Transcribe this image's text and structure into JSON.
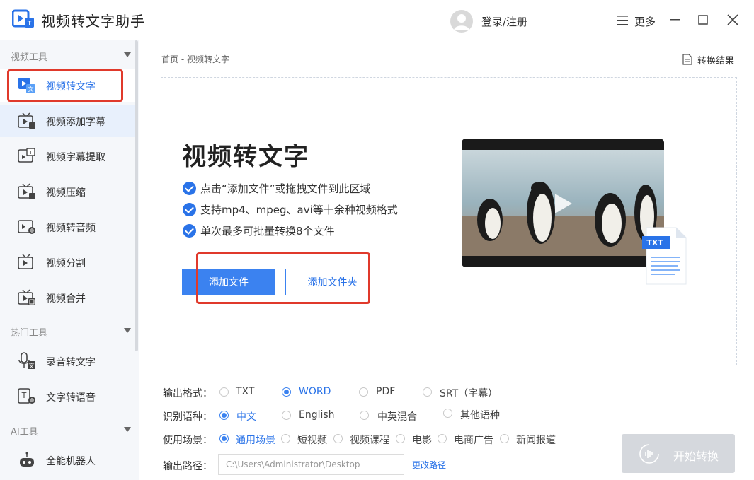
{
  "titlebar": {
    "app_title": "视频转文字助手",
    "login": "登录/注册",
    "more": "更多"
  },
  "sidebar": {
    "groups": [
      {
        "label": "视频工具"
      },
      {
        "label": "热门工具"
      },
      {
        "label": "AI工具"
      }
    ],
    "items": [
      {
        "label": "视频转文字",
        "icon": "video-to-text-icon"
      },
      {
        "label": "视频添加字幕",
        "icon": "tv-subtitle-icon"
      },
      {
        "label": "视频字幕提取",
        "icon": "subtitle-extract-icon"
      },
      {
        "label": "视频压缩",
        "icon": "video-compress-icon"
      },
      {
        "label": "视频转音频",
        "icon": "video-audio-icon"
      },
      {
        "label": "视频分割",
        "icon": "video-split-icon"
      },
      {
        "label": "视频合并",
        "icon": "video-merge-icon"
      },
      {
        "label": "录音转文字",
        "icon": "mic-text-icon"
      },
      {
        "label": "文字转语音",
        "icon": "text-speech-icon"
      },
      {
        "label": "全能机器人",
        "icon": "robot-icon"
      }
    ]
  },
  "main": {
    "breadcrumb": "首页 - 视频转文字",
    "results": "转换结果",
    "hero_title": "视频转文字",
    "features": [
      "点击“添加文件”或拖拽文件到此区域",
      "支持mp4、mpeg、avi等十余种视频格式",
      "单次最多可批量转换8个文件"
    ],
    "add_file": "添加文件",
    "add_folder": "添加文件夹",
    "doc_badge": "TXT"
  },
  "settings": {
    "format_label": "输出格式：",
    "formats": [
      "TXT",
      "WORD",
      "PDF",
      "SRT（字幕）"
    ],
    "format_selected": "WORD",
    "language_label": "识别语种：",
    "languages": [
      "中文",
      "English",
      "中英混合",
      "其他语种"
    ],
    "language_selected": "中文",
    "scene_label": "使用场景：",
    "scenes": [
      "通用场景",
      "短视频",
      "视频课程",
      "电影",
      "电商广告",
      "新闻报道"
    ],
    "scene_selected": "通用场景",
    "path_label": "输出路径：",
    "path_value": "C:\\Users\\Administrator\\Desktop",
    "change_path": "更改路径",
    "start": "开始转换"
  },
  "colors": {
    "accent": "#3b82f0",
    "highlight": "#e0392b",
    "sidebar_bg": "#f5f7fa"
  }
}
